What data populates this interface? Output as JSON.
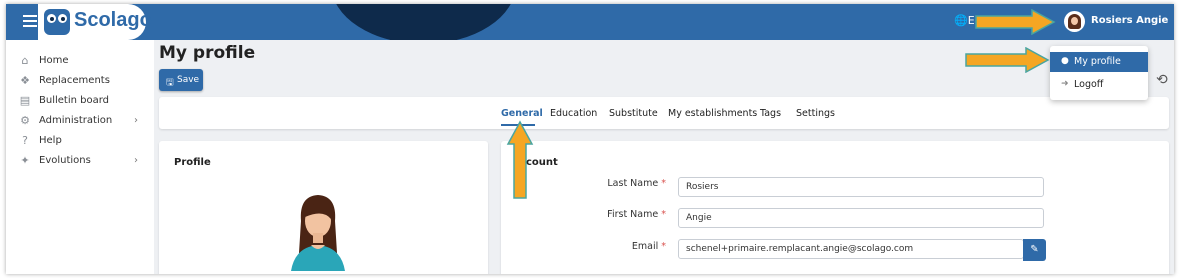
{
  "header": {
    "app_name": "Scolago",
    "language_short": "E",
    "user_name": "Rosiers Angie"
  },
  "user_menu": {
    "items": [
      {
        "label": "My profile",
        "icon": "user-icon",
        "active": true
      },
      {
        "label": "Logoff",
        "icon": "logout-icon",
        "active": false
      }
    ]
  },
  "sidebar": {
    "items": [
      {
        "label": "Home",
        "icon": "home-icon",
        "has_children": false
      },
      {
        "label": "Replacements",
        "icon": "replacements-icon",
        "has_children": false
      },
      {
        "label": "Bulletin board",
        "icon": "bulletin-board-icon",
        "has_children": false
      },
      {
        "label": "Administration",
        "icon": "gear-icon",
        "has_children": true
      },
      {
        "label": "Help",
        "icon": "help-icon",
        "has_children": false
      },
      {
        "label": "Evolutions",
        "icon": "evolutions-icon",
        "has_children": true
      }
    ],
    "chevron": "›"
  },
  "page": {
    "title": "My profile",
    "save_label": "Save"
  },
  "tabs": [
    {
      "label": "General",
      "active": true
    },
    {
      "label": "Education",
      "active": false
    },
    {
      "label": "Substitute",
      "active": false
    },
    {
      "label": "My establishments",
      "active": false
    },
    {
      "label": "Tags",
      "active": false
    },
    {
      "label": "Settings",
      "active": false
    }
  ],
  "profile_card": {
    "title": "Profile"
  },
  "account_card": {
    "title": "count",
    "fields": [
      {
        "label": "Last Name",
        "required": true,
        "value": "Rosiers"
      },
      {
        "label": "First Name",
        "required": true,
        "value": "Angie"
      },
      {
        "label": "Email",
        "required": true,
        "value": "schenel+primaire.remplacant.angie@scolago.com"
      }
    ],
    "required_mark": "*"
  },
  "colors": {
    "brand_blue": "#2f6aa8",
    "header_dark": "#0e2a4b",
    "annotation_arrow": "#f5a623",
    "annotation_arrow_outline": "#4aa5a0"
  }
}
